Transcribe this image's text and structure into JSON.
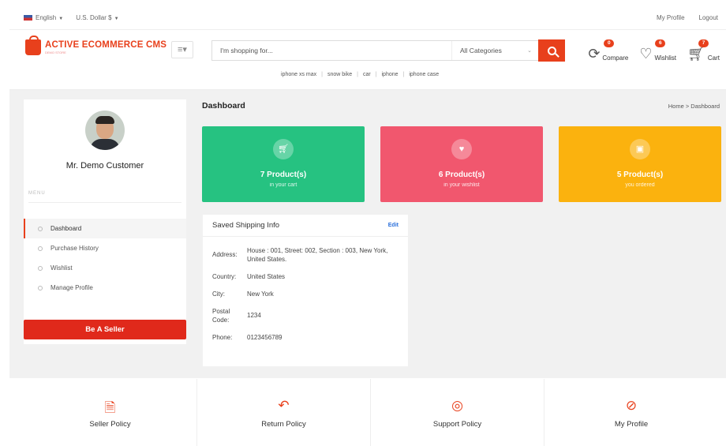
{
  "topbar": {
    "language": "English",
    "currency": "U.S. Dollar $",
    "my_profile": "My Profile",
    "logout": "Logout"
  },
  "header": {
    "logo_text": "ACTIVE ECOMMERCE CMS",
    "logo_sub": "DEMO STORE",
    "search_placeholder": "I'm shopping for...",
    "category_selected": "All Categories",
    "suggestions": [
      "iphone xs max",
      "snow bike",
      "car",
      "iphone",
      "iphone case"
    ],
    "compare": {
      "label": "Compare",
      "count": "0"
    },
    "wishlist": {
      "label": "Wishlist",
      "count": "6"
    },
    "cart": {
      "label": "Cart",
      "count": "7"
    }
  },
  "sidebar": {
    "user_name": "Mr. Demo Customer",
    "menu_label": "MENU",
    "items": [
      {
        "label": "Dashboard",
        "active": true
      },
      {
        "label": "Purchase History",
        "active": false
      },
      {
        "label": "Wishlist",
        "active": false
      },
      {
        "label": "Manage Profile",
        "active": false
      }
    ],
    "seller_button": "Be A Seller"
  },
  "dashboard": {
    "title": "Dashboard",
    "breadcrumb": "Home > Dashboard",
    "cards": [
      {
        "title": "7 Product(s)",
        "sub": "in your cart",
        "color": "#26c281",
        "icon": "cart-icon"
      },
      {
        "title": "6 Product(s)",
        "sub": "in your wishlist",
        "color": "#f1576e",
        "icon": "heart-icon"
      },
      {
        "title": "5 Product(s)",
        "sub": "you ordered",
        "color": "#fbb20e",
        "icon": "box-icon"
      }
    ],
    "shipping": {
      "title": "Saved Shipping Info",
      "edit": "Edit",
      "address_label": "Address:",
      "address": "House : 001, Street: 002, Section : 003, New York, United States.",
      "country_label": "Country:",
      "country": "United States",
      "city_label": "City:",
      "city": "New York",
      "postal_label": "Postal Code:",
      "postal": "1234",
      "phone_label": "Phone:",
      "phone": "0123456789"
    }
  },
  "footer": {
    "seller_policy": "Seller Policy",
    "return_policy": "Return Policy",
    "support_policy": "Support Policy",
    "my_profile": "My Profile"
  },
  "colors": {
    "accent": "#e8401c",
    "green": "#26c281",
    "pink": "#f1576e",
    "yellow": "#fbb20e"
  }
}
